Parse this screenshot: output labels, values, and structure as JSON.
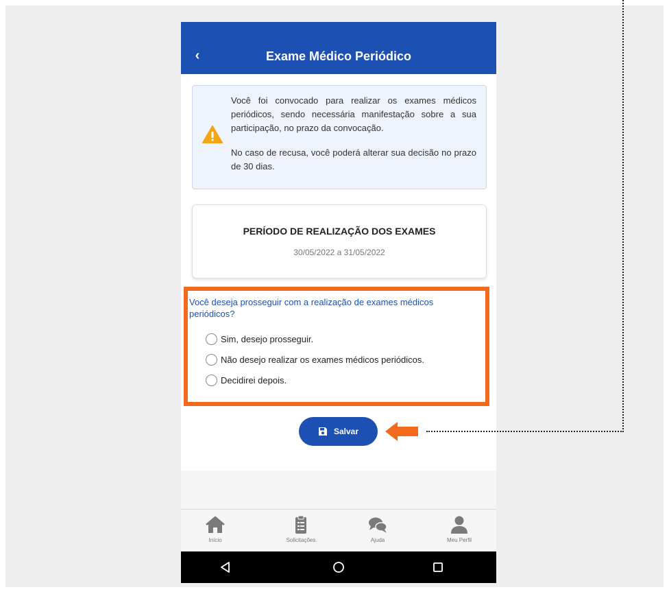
{
  "header": {
    "back_icon": "chevron-left-icon",
    "back_glyph": "‹",
    "title": "Exame Médico Periódico"
  },
  "alert": {
    "icon": "warning-icon",
    "paragraph1": "Você foi convocado para realizar os exames médicos periódicos, sendo necessária manifestação sobre a sua participação, no prazo da convocação.",
    "paragraph2": "No caso de recusa, você poderá alterar sua decisão no prazo de 30 dias."
  },
  "period": {
    "title": "PERÍODO DE REALIZAÇÃO DOS EXAMES",
    "dates": "30/05/2022 a 31/05/2022"
  },
  "question": {
    "label": "Você deseja prosseguir com a realização de exames médicos periódicos?",
    "options": [
      {
        "label": "Sim, desejo prosseguir.",
        "selected": false
      },
      {
        "label": "Não desejo realizar os exames médicos periódicos.",
        "selected": false
      },
      {
        "label": "Decidirei depois.",
        "selected": false
      }
    ]
  },
  "save_button": {
    "icon": "floppy-disk-icon",
    "label": "Salvar"
  },
  "bottom_nav": {
    "items": [
      {
        "label": "Início",
        "icon": "home-icon"
      },
      {
        "label": "Solicitações",
        "icon": "clipboard-icon"
      },
      {
        "label": "Ajuda",
        "icon": "chat-bubbles-icon"
      },
      {
        "label": "Meu Perfil",
        "icon": "user-icon"
      }
    ]
  },
  "system_bar": {
    "back_icon": "triangle-back-icon",
    "home_icon": "circle-home-icon",
    "recents_icon": "square-recents-icon"
  },
  "colors": {
    "primary": "#1c50b3",
    "highlight": "#f26b1d",
    "warning": "#f2a515",
    "alert_bg": "#eef3fc"
  }
}
